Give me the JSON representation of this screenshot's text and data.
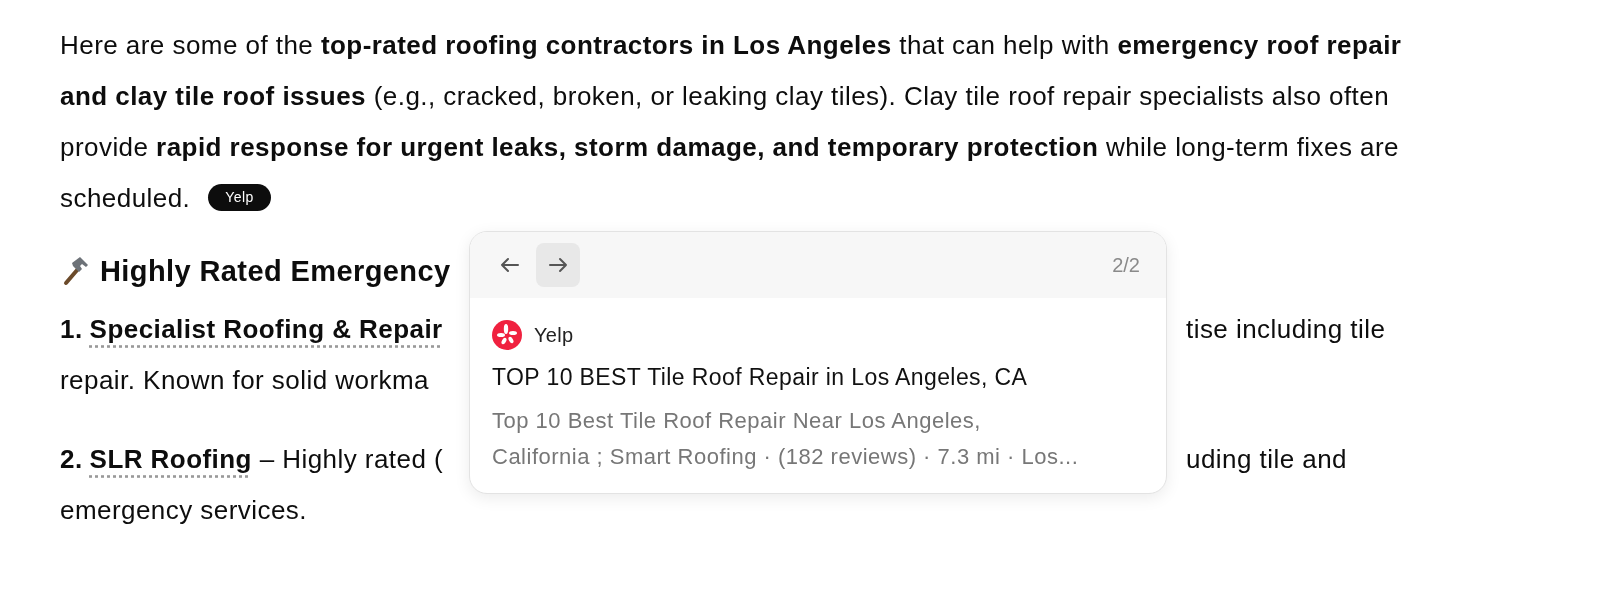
{
  "intro": {
    "text": "Here are some of the **top-rated roofing contractors in Los Angeles** that can help with **emergency roof repair and clay tile roof issues** (e.g., cracked, broken, or leaking clay tiles). Clay tile roof repair specialists also often provide **rapid response for urgent leaks, storm damage, and temporary protection** while long-term fixes are scheduled.",
    "source_badge": "Yelp"
  },
  "section": {
    "heading": "Highly Rated Emergency"
  },
  "items": [
    {
      "number": "1.",
      "name": "Specialist Roofing & Repair",
      "line_end": "tise including tile",
      "continuation": "repair. Known for solid workma"
    },
    {
      "number": "2.",
      "name": "SLR Roofing",
      "after_name": "– Highly rated (",
      "line_end": "uding tile and",
      "continuation": "emergency services."
    }
  ],
  "popover": {
    "nav": [
      {
        "kind": "back",
        "highlighted": false
      },
      {
        "kind": "forward",
        "highlighted": true
      }
    ],
    "counter": "2/2",
    "source": {
      "name": "Yelp"
    },
    "title": "TOP 10 BEST Tile Roof Repair in Los Angeles, CA",
    "snippet_lines": [
      "Top 10 Best Tile Roof Repair Near Los Angeles,",
      "California ; Smart Roofing · (182 reviews) · 7.3 mi · Los..."
    ]
  }
}
